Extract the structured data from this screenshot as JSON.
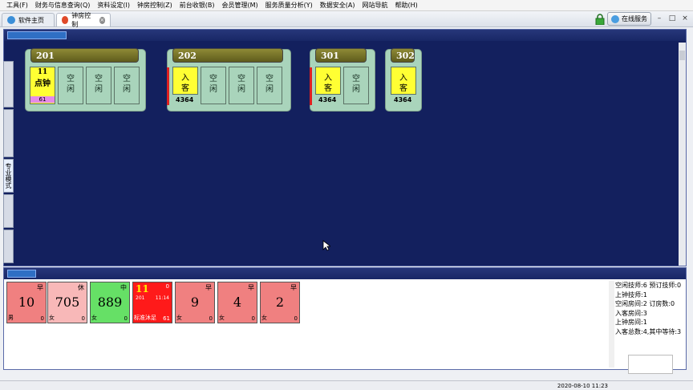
{
  "menubar": {
    "items": [
      "工具(F)",
      "财务与信息查询(Q)",
      "资料设定(I)",
      "钟房控制(Z)",
      "前台收银(B)",
      "会员管理(M)",
      "服务质量分析(Y)",
      "数据安全(A)",
      "网站导航",
      "帮助(H)"
    ]
  },
  "tabs": {
    "home": "软件主页",
    "active": "钟房控制"
  },
  "online_service": "在线服务",
  "room_toolbar": {
    "title": "",
    "items": [
      "",
      "",
      "",
      "",
      "",
      "",
      "",
      "",
      "",
      "",
      "",
      "",
      ""
    ]
  },
  "vertical_tabs": [
    "",
    "",
    "专业模式",
    "",
    ""
  ],
  "rooms": [
    {
      "name": "201",
      "beds": [
        {
          "state": "occupied",
          "tech": "11",
          "text": "点钟",
          "number": "61"
        },
        {
          "state": "idle",
          "text1": "空",
          "text2": "闲"
        },
        {
          "state": "idle",
          "text1": "空",
          "text2": "闲"
        },
        {
          "state": "idle",
          "text1": "空",
          "text2": "闲"
        }
      ]
    },
    {
      "name": "202",
      "beds": [
        {
          "state": "occupied",
          "text1": "入",
          "text2": "客"
        },
        {
          "state": "idle",
          "text1": "空",
          "text2": "闲"
        },
        {
          "state": "idle",
          "text1": "空",
          "text2": "闲"
        },
        {
          "state": "idle",
          "text1": "空",
          "text2": "闲"
        }
      ],
      "code": "4364"
    },
    {
      "name": "301",
      "beds": [
        {
          "state": "occupied",
          "text1": "入",
          "text2": "客"
        },
        {
          "state": "idle",
          "text1": "空",
          "text2": "闲"
        }
      ],
      "code": "4364"
    },
    {
      "name": "302",
      "beds": [
        {
          "state": "occupied",
          "text1": "入",
          "text2": "客"
        }
      ],
      "code": "4364"
    }
  ],
  "tech_toolbar": {
    "title": "",
    "left_items": [
      "",
      "",
      "",
      "",
      "",
      "",
      "",
      "",
      "",
      "",
      "",
      "",
      "",
      "",
      "",
      "",
      ""
    ],
    "right_items": [
      "",
      "",
      "",
      "",
      ""
    ]
  },
  "technicians": [
    {
      "id": "10",
      "status": "早",
      "gender": "男",
      "count": "0",
      "color": "#f08080"
    },
    {
      "id": "705",
      "status": "休",
      "gender": "女",
      "count": "0",
      "color": "#f8b8b8"
    },
    {
      "id": "889",
      "status": "中",
      "gender": "女",
      "count": "0",
      "color": "#66e066"
    },
    {
      "id": "11",
      "status": "0",
      "room": "201",
      "time": "11:14",
      "label": "标准沐足",
      "count": "61",
      "color": "#ff1a1a",
      "busy": true
    },
    {
      "id": "9",
      "status": "早",
      "gender": "女",
      "count": "0",
      "color": "#f08080"
    },
    {
      "id": "4",
      "status": "早",
      "gender": "女",
      "count": "0",
      "color": "#f08080"
    },
    {
      "id": "2",
      "status": "早",
      "gender": "女",
      "count": "0",
      "color": "#f08080"
    }
  ],
  "stats": [
    "空闲技师:6  预订技师:0",
    "上钟技师:1",
    "空闲房间:2  订房数:0",
    "入客房间:3",
    "上钟房间:1",
    "入客总数:4,其中等待:3"
  ],
  "ie_popup": {
    "line1": "",
    "line2": ""
  },
  "statusbar": {
    "items": [
      "",
      "",
      "",
      "",
      "",
      "",
      "",
      "",
      "",
      "",
      "",
      "",
      "",
      "",
      ""
    ],
    "time": "2020-08-10 11:23"
  }
}
